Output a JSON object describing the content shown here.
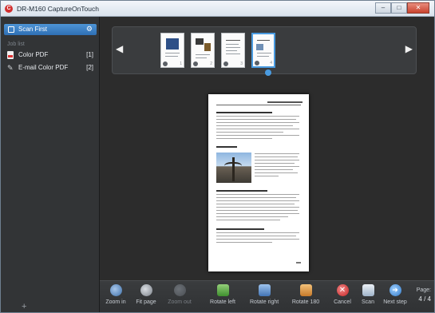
{
  "window": {
    "title": "DR-M160 CaptureOnTouch",
    "app_icon_glyph": "C",
    "controls": {
      "minimize": "–",
      "maximize": "□",
      "close": "✕"
    }
  },
  "sidebar": {
    "selected_job": "Scan First",
    "section_label": "Job list",
    "items": [
      {
        "label": "Color PDF",
        "count": "[1]",
        "icon": "pdf-icon"
      },
      {
        "label": "E-mail Color PDF",
        "count": "[2]",
        "icon": "paperclip-icon"
      }
    ],
    "add_glyph": "+"
  },
  "thumbnails": {
    "prev_glyph": "◀",
    "next_glyph": "▶",
    "pages": [
      {
        "num": "1"
      },
      {
        "num": "2"
      },
      {
        "num": "3"
      },
      {
        "num": "4"
      }
    ]
  },
  "toolbar": {
    "zoom_in": "Zoom in",
    "fit_page": "Fit page",
    "zoom_out": "Zoom out",
    "rotate_left": "Rotate left",
    "rotate_right": "Rotate right",
    "rotate_180": "Rotate 180",
    "cancel": "Cancel",
    "scan": "Scan",
    "next_step": "Next step",
    "page_label": "Page:",
    "page_value": "4 / 4"
  },
  "colors": {
    "accent": "#3a82cc",
    "background": "#2c2c2c",
    "sidebar": "#323436"
  }
}
